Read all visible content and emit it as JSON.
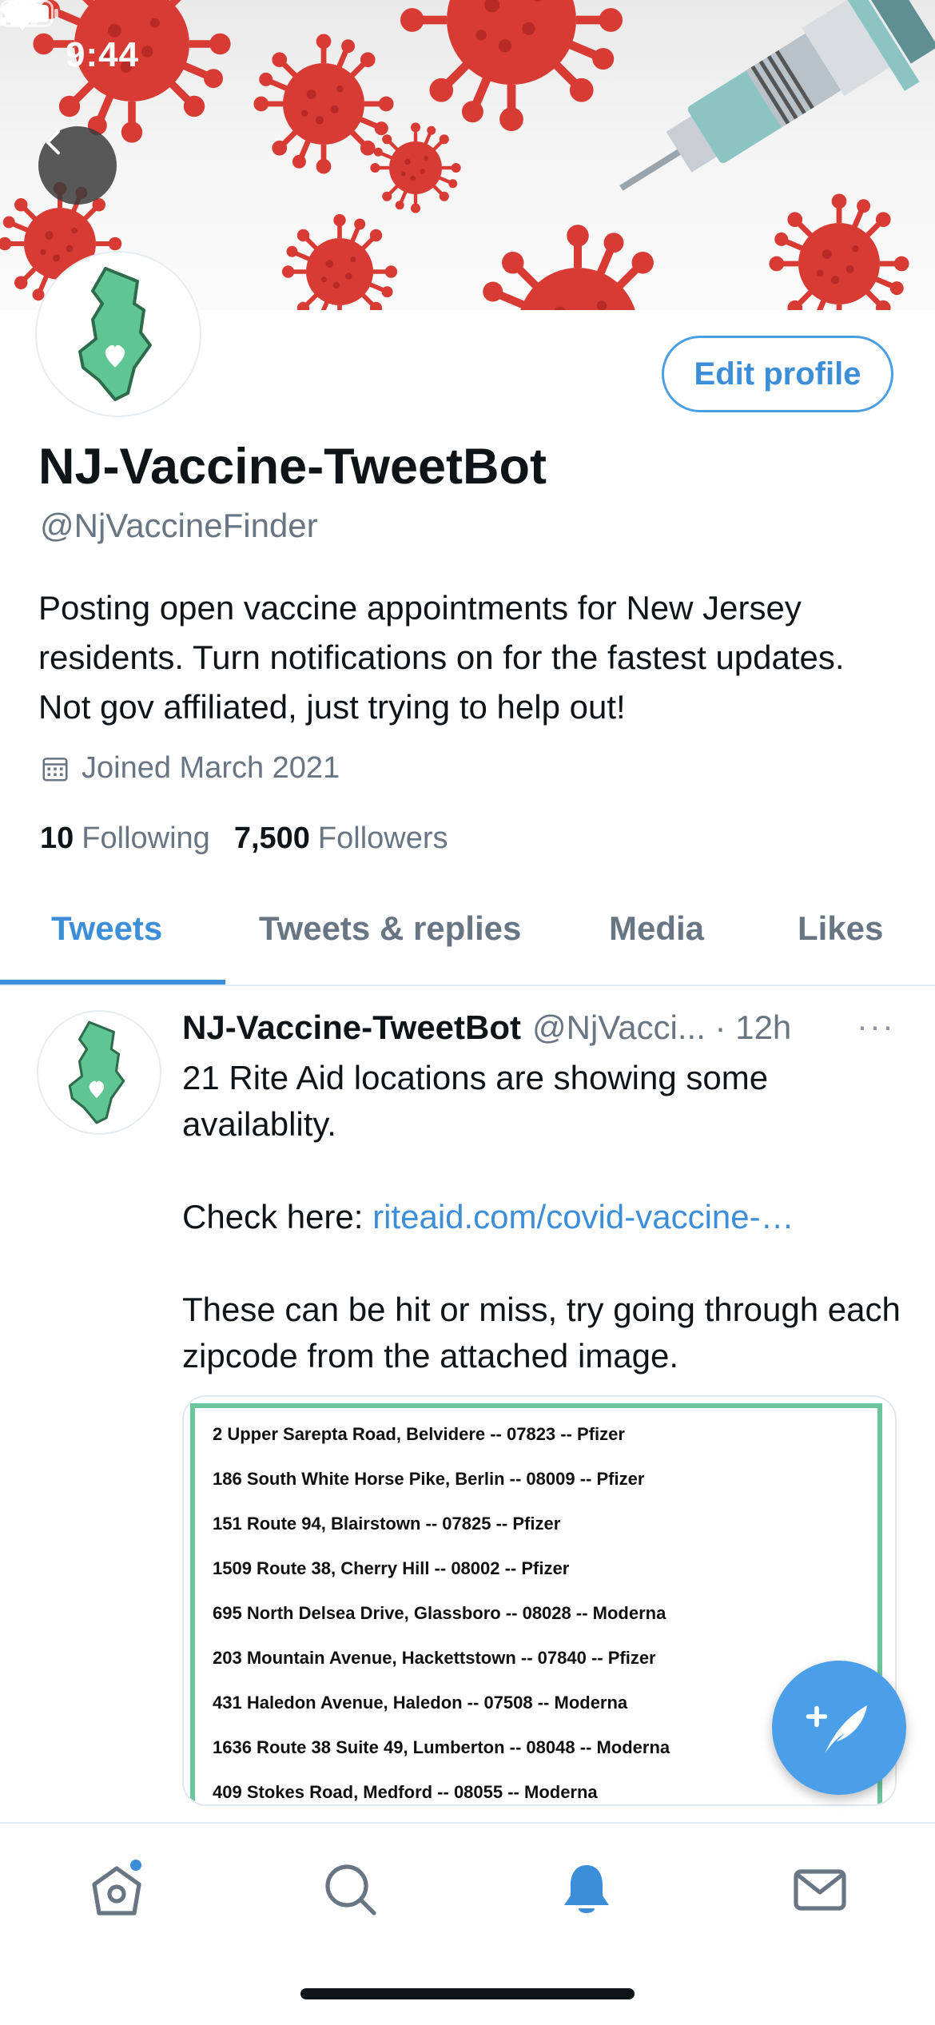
{
  "status_bar": {
    "time": "9:44"
  },
  "profile": {
    "display_name": "NJ-Vaccine-TweetBot",
    "handle": "@NjVaccineFinder",
    "bio": "Posting open vaccine appointments for New Jersey residents. Turn notifications on for the fastest updates. Not gov affiliated, just trying to help out!",
    "joined": "Joined March 2021",
    "following_count": "10",
    "following_label": "Following",
    "followers_count": "7,500",
    "followers_label": "Followers",
    "edit_profile_label": "Edit profile"
  },
  "tabs": [
    {
      "label": "Tweets",
      "active": true
    },
    {
      "label": "Tweets & replies"
    },
    {
      "label": "Media"
    },
    {
      "label": "Likes"
    }
  ],
  "tweet": {
    "name": "NJ-Vaccine-TweetBot",
    "handle_time": "@NjVacci... · 12h",
    "more": "···",
    "line1": "21 Rite Aid locations are showing some availablity.",
    "check_prefix": "Check here: ",
    "link": "riteaid.com/covid-vaccine-…",
    "line3": "These can be hit or miss, try going through each zipcode from the attached image.",
    "image_rows": [
      "2 Upper Sarepta Road, Belvidere -- 07823 -- Pfizer",
      "186 South White Horse Pike, Berlin -- 08009 -- Pfizer",
      "151 Route 94, Blairstown -- 07825 -- Pfizer",
      "1509 Route 38, Cherry Hill -- 08002 -- Pfizer",
      "695 North Delsea Drive, Glassboro -- 08028 -- Moderna",
      "203 Mountain Avenue, Hackettstown -- 07840 -- Pfizer",
      "431 Haledon Avenue, Haledon -- 07508 -- Moderna",
      "1636 Route 38 Suite 49, Lumberton -- 08048 -- Moderna",
      "409 Stokes Road, Medford -- 08055 -- Moderna"
    ]
  },
  "icons": {
    "back": "chevron-left-icon",
    "calendar": "calendar-icon",
    "compose": "compose-tweet-icon",
    "nav": [
      "home-icon",
      "search-icon",
      "notifications-bell-icon",
      "messages-envelope-icon"
    ]
  },
  "colors": {
    "accent": "#3d8ed8",
    "secondary_text": "#687684",
    "fab": "#4a9fe8",
    "nj_green": "#5fc592",
    "virus_red": "#d83a34"
  }
}
